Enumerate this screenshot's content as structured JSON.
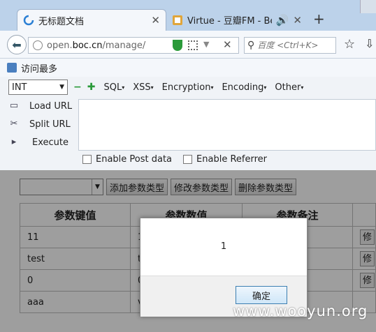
{
  "browser": {
    "tabs": [
      {
        "title": "无标题文档"
      },
      {
        "title": "Virtue - 豆瓣FM - Beta"
      }
    ],
    "new_tab": "+",
    "url_prefix": "open.",
    "url_host": "boc.cn",
    "url_path": "/manage/",
    "search_placeholder": "百度 <Ctrl+K>",
    "bookmark": "访问最多"
  },
  "hackbar": {
    "select_value": "INT",
    "menus": [
      "SQL",
      "XSS",
      "Encryption",
      "Encoding",
      "Other"
    ],
    "load_url": "Load URL",
    "split_url": "Split URL",
    "execute": "Execute",
    "enable_post": "Enable Post data",
    "enable_referrer": "Enable Referrer"
  },
  "page": {
    "buttons": [
      "添加参数类型",
      "修改参数类型",
      "删除参数类型"
    ],
    "headers": [
      "参数键值",
      "参数数值",
      "参数备注",
      ""
    ],
    "rows": [
      {
        "key": "11",
        "value": "1",
        "edit": "修"
      },
      {
        "key": "test",
        "value": "t",
        "edit": "修"
      },
      {
        "key": "0",
        "value": "0",
        "edit": "修"
      },
      {
        "key": "aaa",
        "value": "v",
        "edit": ""
      }
    ]
  },
  "dialog": {
    "message": "1",
    "ok_label": "确定"
  },
  "watermark": "www.wooyun.org"
}
